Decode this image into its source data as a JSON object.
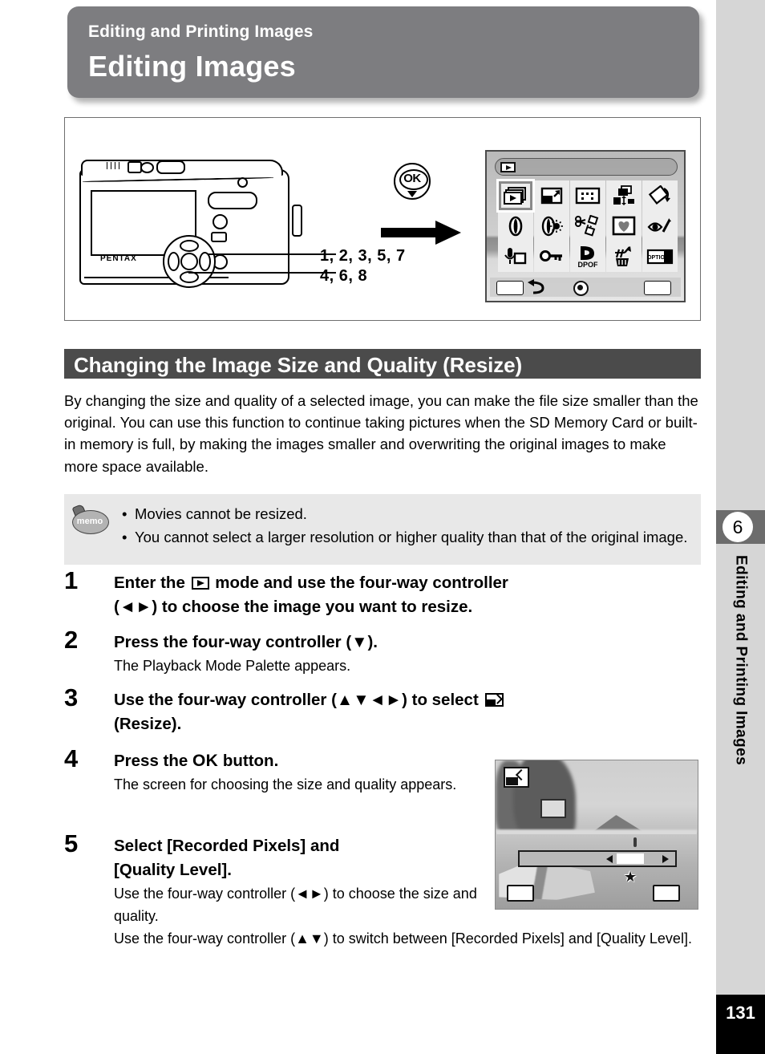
{
  "header": {
    "chapter": "Editing and Printing Images",
    "title": "Editing Images"
  },
  "illustration": {
    "camera_brand": "PENTAX",
    "ok_button_label": "OK",
    "step_labels_line1": "1, 2, 3, 5, 7",
    "step_labels_line2": "4, 6, 8",
    "palette": {
      "selected_index": 0,
      "icons": [
        "slideshow-icon",
        "resize-icon",
        "trim-icon",
        "image-copy-icon",
        "image-rotation-icon",
        "digital-filter-icon",
        "brightness-filter-icon",
        "frame-composite-icon",
        "heart-frame-icon",
        "red-eye-compensation-icon",
        "voice-memo-icon",
        "protect-icon",
        "dpof-icon",
        "delete-icon",
        "start-screen-icon"
      ],
      "dpof_label": "DPOF",
      "optio_label": "OPTIO"
    }
  },
  "section": {
    "heading": "Changing the Image Size and Quality (Resize)",
    "intro": "By changing the size and quality of a selected image, you can make the file size smaller than the original. You can use this function to continue taking pictures when the SD Memory Card or built-in memory is full, by making the images smaller and overwriting the original images to make more space available."
  },
  "memo": {
    "badge_label": "memo",
    "items": [
      "Movies cannot be resized.",
      "You cannot select a larger resolution or higher quality than that of the original image."
    ]
  },
  "steps": [
    {
      "num": "1",
      "head_part1": "Enter the",
      "head_part2": "mode and use the four-way controller",
      "head_part3": "(◄►) to choose the image you want to resize.",
      "body": ""
    },
    {
      "num": "2",
      "head_part1": "Press the four-way controller (▼).",
      "body": "The Playback Mode Palette appears."
    },
    {
      "num": "3",
      "head_part1": "Use the four-way controller (▲▼◄►) to select",
      "head_part2": "(Resize).",
      "body": ""
    },
    {
      "num": "4",
      "head_part1": "Press the",
      "head_ok": "OK",
      "head_part2": "button.",
      "body": "The screen for choosing the size and quality appears."
    },
    {
      "num": "5",
      "head_part1": "Select [Recorded Pixels] and",
      "head_part2": "[Quality Level].",
      "body": "Use the four-way controller (◄►) to choose the size and quality.",
      "body2": "Use the four-way controller (▲▼) to switch between [Recorded Pixels] and [Quality Level]."
    }
  ],
  "sidebar": {
    "chapter_number": "6",
    "chapter_title": "Editing and Printing Images",
    "page_number": "131"
  },
  "colors": {
    "header_gray": "#7d7d80",
    "section_gray": "#4b4b4b",
    "memo_gray": "#e8e8e8",
    "sidebar_gray": "#d6d6d6",
    "tab_gray": "#6c6c6c",
    "page_black": "#000000"
  }
}
